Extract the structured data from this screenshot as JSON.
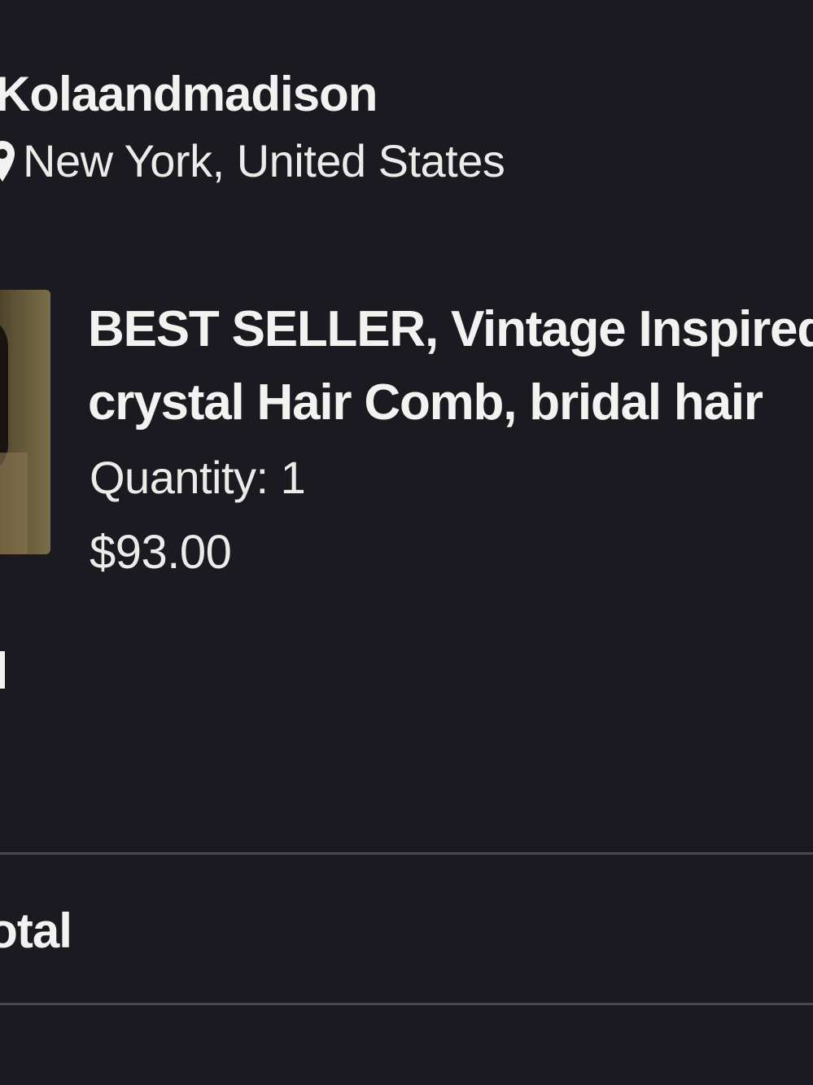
{
  "shop": {
    "name": "Kolaandmadison",
    "location": "New York, United States",
    "location_icon": "map-pin-icon"
  },
  "item": {
    "title_line1": "BEST SELLER, Vintage Inspired",
    "title_line2": "crystal Hair Comb, bridal hair",
    "quantity_label": "Quantity: 1",
    "price": "$93.00",
    "thumbnail": "item-thumbnail-image"
  },
  "summary": {
    "total_label": "Total"
  },
  "colors": {
    "background": "#1c1a21",
    "text": "#f4f2f0",
    "divider": "#4a4750"
  }
}
